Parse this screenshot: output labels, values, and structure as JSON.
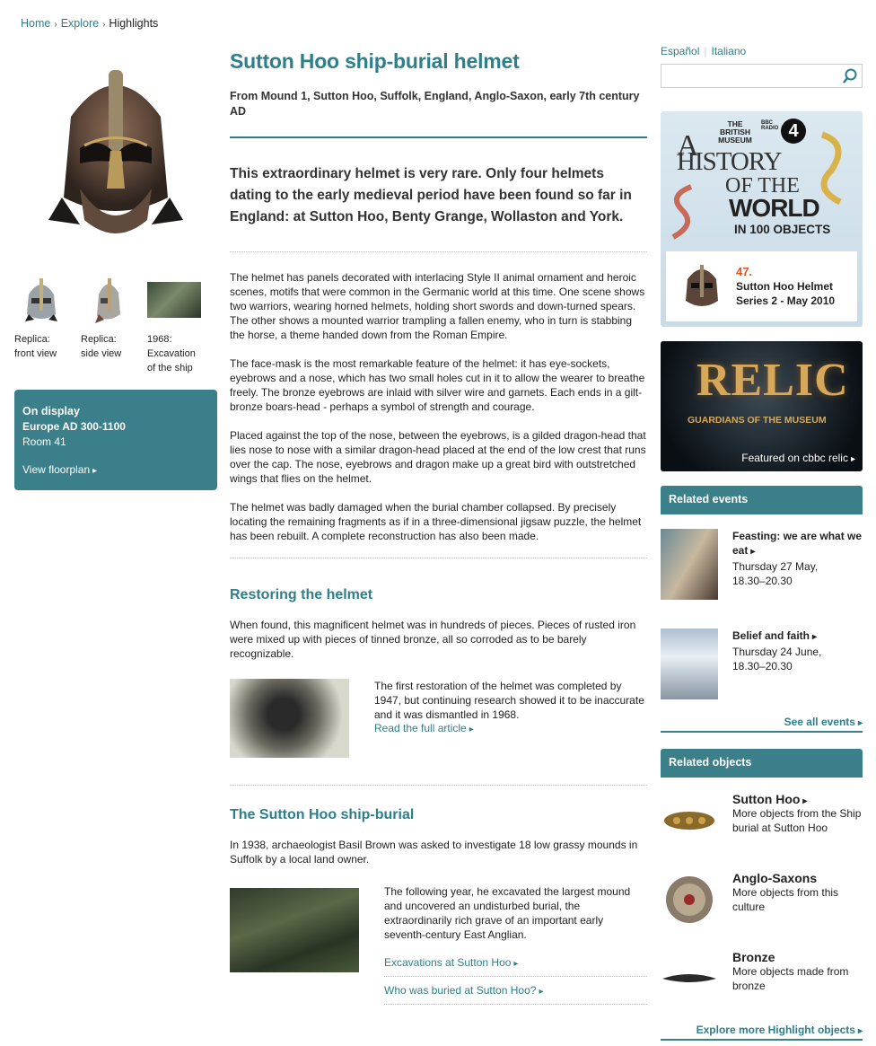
{
  "breadcrumb": {
    "home": "Home",
    "explore": "Explore",
    "current": "Highlights"
  },
  "left": {
    "thumbs": [
      {
        "caption": "Replica: front view"
      },
      {
        "caption": "Replica: side view"
      },
      {
        "caption": "1968: Excavation of the ship"
      }
    ],
    "display": {
      "heading": "On display",
      "gallery": "Europe AD 300-1100",
      "room": "Room 41",
      "floorplan": "View floorplan"
    }
  },
  "main": {
    "title": "Sutton Hoo ship-burial helmet",
    "subtitle": "From Mound 1, Sutton Hoo, Suffolk, England, Anglo-Saxon, early 7th century AD",
    "lead": "This extraordinary helmet is very rare. Only four helmets dating to the early medieval period have been found so far in England: at Sutton Hoo, Benty Grange, Wollaston and York.",
    "paragraphs": [
      "The helmet has panels decorated with interlacing Style II animal ornament and heroic scenes, motifs that were common in the Germanic world at this time. One scene shows two warriors, wearing horned helmets, holding short swords and down-turned spears. The other shows a mounted warrior trampling a fallen enemy, who in turn is stabbing the horse, a theme handed down from the Roman Empire.",
      "The face-mask is the most remarkable feature of the helmet: it has eye-sockets, eyebrows and a nose, which has two small holes cut in it to allow the wearer to breathe freely. The bronze eyebrows are inlaid with silver wire and garnets. Each ends in a gilt-bronze boars-head - perhaps a symbol of strength and courage.",
      "Placed against the top of the nose, between the eyebrows, is a gilded dragon-head that lies nose to nose with a similar dragon-head placed at the end of the low crest that runs over the cap. The nose, eyebrows and dragon make up a great bird with outstretched wings that flies on the helmet.",
      "The helmet was badly damaged when the burial chamber collapsed. By precisely locating the remaining fragments as if in a three-dimensional jigsaw puzzle, the helmet has been rebuilt. A complete reconstruction has also been made."
    ],
    "restoring": {
      "heading": "Restoring the helmet",
      "intro": "When found, this magnificent helmet was in hundreds of pieces. Pieces of rusted iron were mixed up with pieces of tinned bronze, all so corroded as to be barely recognizable.",
      "text": "The first restoration of the helmet was completed by 1947, but continuing research showed it to be inaccurate and it was dismantled in 1968.",
      "link": "Read the full article"
    },
    "shipburial": {
      "heading": "The Sutton Hoo ship-burial",
      "intro": "In 1938, archaeologist Basil Brown was asked to investigate 18 low grassy mounds in Suffolk by a local land owner.",
      "text": "The following year, he excavated the largest mound and uncovered an undisturbed burial, the extraordinarily rich grave of an important early seventh-century East Anglian.",
      "link1": "Excavations at Sutton Hoo",
      "link2": "Who was buried at Sutton Hoo?"
    }
  },
  "right": {
    "lang1": "Español",
    "lang2": "Italiano",
    "promo": {
      "museum": "THE BRITISH MUSEUM",
      "radio": "BBC RADIO",
      "number4": "4",
      "a": "A",
      "history": "HISTORY",
      "of_the": "OF THE",
      "world": "WORLD",
      "in100": "IN 100 OBJECTS",
      "num": "47.",
      "obj": "Sutton Hoo Helmet",
      "series": "Series 2 - May 2010"
    },
    "relic": {
      "title": "RELIC",
      "tag": "GUARDIANS OF THE MUSEUM",
      "caption": "Featured on cbbc relic"
    },
    "events": {
      "heading": "Related events",
      "items": [
        {
          "title": "Feasting: we are what we eat",
          "date": "Thursday 27 May,",
          "time": "18.30–20.30"
        },
        {
          "title": "Belief and faith",
          "date": "Thursday 24 June,",
          "time": "18.30–20.30"
        }
      ],
      "see_all": "See all events"
    },
    "objects": {
      "heading": "Related objects",
      "items": [
        {
          "title": "Sutton Hoo",
          "desc": "More objects from the Ship burial at Sutton Hoo"
        },
        {
          "title": "Anglo-Saxons",
          "desc": "More objects from this culture"
        },
        {
          "title": "Bronze",
          "desc": "More objects made from bronze"
        }
      ],
      "explore_more": "Explore more Highlight objects"
    }
  }
}
